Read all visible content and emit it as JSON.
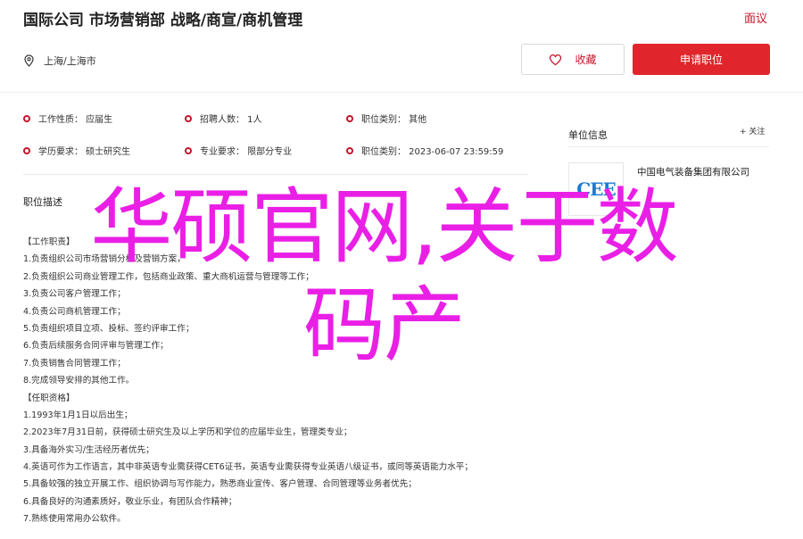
{
  "header": {
    "title": "国际公司 市场营销部 战略/商宣/商机管理",
    "report_label": "面议",
    "location": "上海/上海市",
    "favorite_label": "收藏",
    "apply_label": "申请职位"
  },
  "fields": {
    "nature": "工作性质： 应届生",
    "headcount": "招聘人数： 1人",
    "salary": "职位类别： 其他",
    "education": "学历要求： 硕士研究生",
    "major": "专业要求： 限部分专业",
    "date": "职位类别： 2023-06-07 23:59:59"
  },
  "description": {
    "heading": "职位描述",
    "lines": [
      "【工作职责】",
      "1.负责组织公司市场营销分析及营销方案，",
      "2.负责组织公司商业管理工作，包括商业政策、重大商机运营与管理等工作；",
      "3.负责公司客户管理工作；",
      "4.负责公司商机管理工作；",
      "5.负责组织项目立项、投标、签约评审工作；",
      "6.负责后续服务合同评审与管理工作；",
      "7.负责销售合同管理工作；",
      "8.完成领导安排的其他工作。",
      "【任职资格】",
      "1.1993年1月1日以后出生；",
      "2.2023年7月31日前，获得硕士研究生及以上学历和学位的应届毕业生，管理类专业；",
      "3.具备海外实习/生活经历者优先；",
      "4.英语可作为工作语言，其中非英语专业需获得CET6证书，英语专业需获得专业英语八级证书，或同等英语能力水平；",
      "5.具备较强的独立开展工作、组织协调与写作能力，熟悉商业宣传、客户管理、合同管理等业务者优先；",
      "6.具备良好的沟通素质好，敬业乐业，有团队合作精神；",
      "7.熟练使用常用办公软件。"
    ]
  },
  "sidebar": {
    "title": "单位信息",
    "follow_label": "+ 关注",
    "logo_text": "CEE",
    "company_name": "中国电气装备集团有限公司"
  },
  "overlay": {
    "line1": "华硕官网,关于数",
    "line2": "码产"
  },
  "colors": {
    "accent": "#e0262c",
    "overlay": "#ea1fe6"
  }
}
